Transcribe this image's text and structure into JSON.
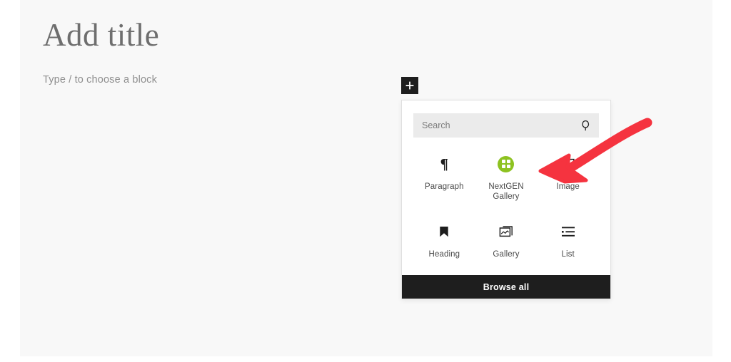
{
  "editor": {
    "title": "Add title",
    "block_prompt": "Type / to choose a block"
  },
  "inserter": {
    "toggle_icon": "plus-icon",
    "search": {
      "placeholder": "Search",
      "value": "",
      "icon": "search-icon"
    },
    "blocks": [
      {
        "label": "Paragraph",
        "icon": "paragraph-pilcrow-icon"
      },
      {
        "label": "NextGEN Gallery",
        "icon": "nextgen-gallery-icon"
      },
      {
        "label": "Image",
        "icon": "image-icon"
      },
      {
        "label": "Heading",
        "icon": "heading-bookmark-icon"
      },
      {
        "label": "Gallery",
        "icon": "gallery-stack-icon"
      },
      {
        "label": "List",
        "icon": "list-icon"
      }
    ],
    "browse_all_label": "Browse all"
  },
  "annotation": {
    "arrow_icon": "red-curved-arrow",
    "arrow_color": "#f5333f",
    "points_to": "NextGEN Gallery"
  },
  "colors": {
    "canvas": "#f8f8f8",
    "page": "#ffffff",
    "dark": "#1e1e1e",
    "search_field": "#ebebeb",
    "nextgen_green": "#8dc220",
    "annotation_red": "#f5333f",
    "title_text": "#6e6e6e",
    "prompt_text": "#8f8f8f"
  }
}
